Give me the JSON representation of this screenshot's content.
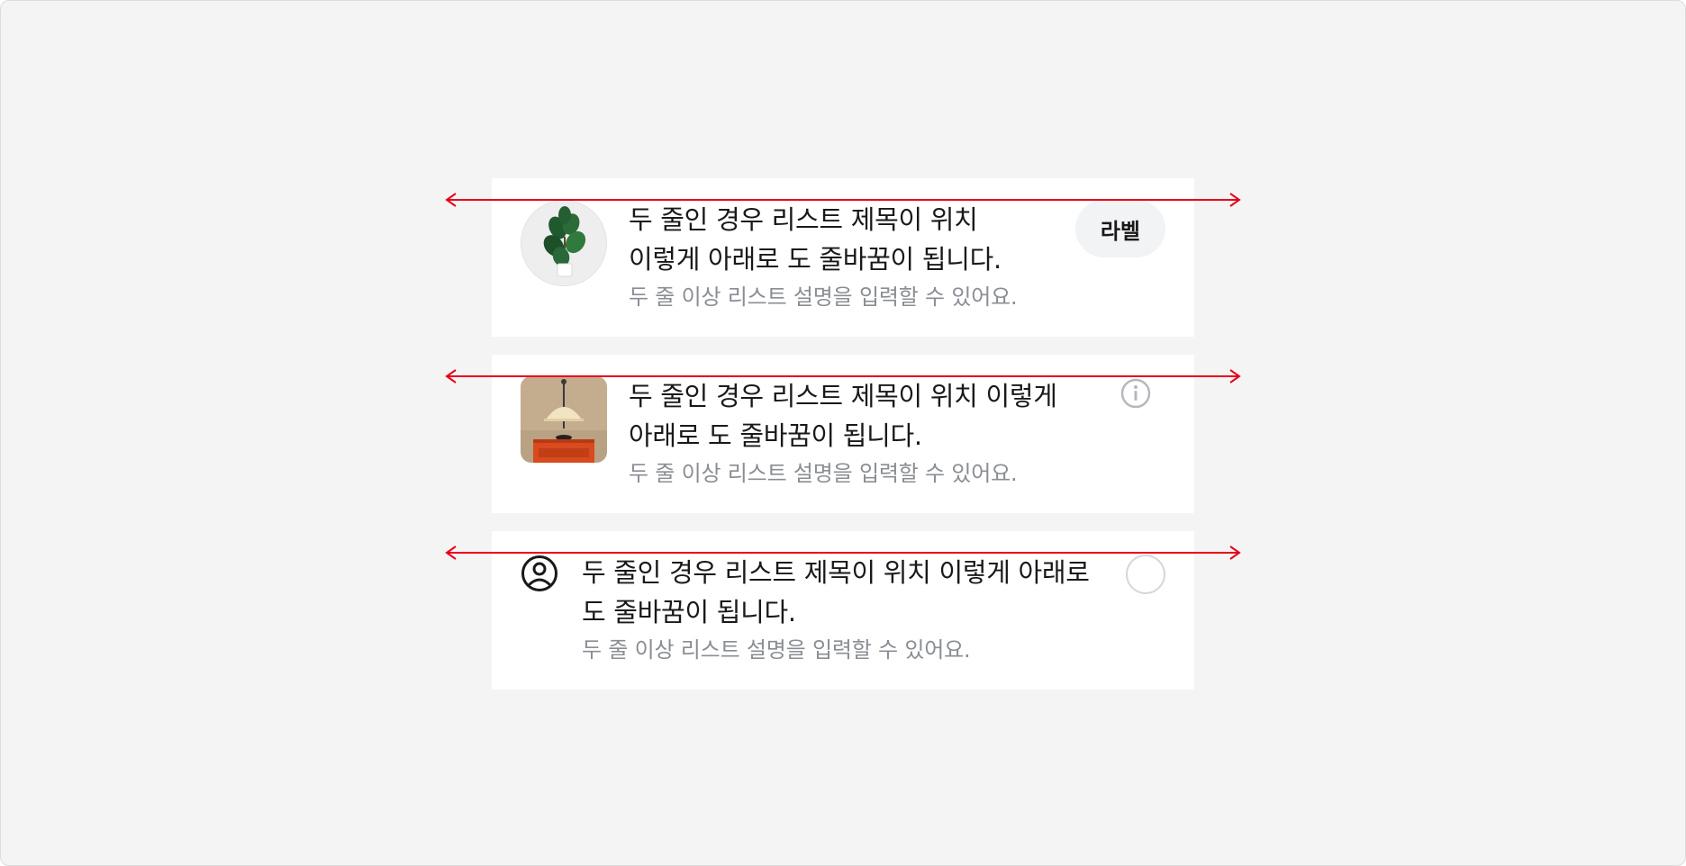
{
  "colors": {
    "background": "#f4f4f4",
    "card": "#ffffff",
    "title_text": "#191919",
    "description_text": "#8a8d93",
    "chip_background": "#f2f3f5",
    "guide_line": "#e8001c"
  },
  "items": [
    {
      "leading": "plant-thumbnail",
      "title": "두 줄인 경우 리스트 제목이 위치 이렇게 아래로 도 줄바꿈이 됩니다.",
      "description": "두 줄 이상 리스트 설명을 입력할 수 있어요.",
      "trailing": {
        "type": "label-chip",
        "label": "라벨"
      }
    },
    {
      "leading": "lamp-thumbnail",
      "title": "두 줄인 경우 리스트 제목이 위치 이렇게 아래로 도 줄바꿈이 됩니다.",
      "description": "두 줄 이상 리스트 설명을 입력할 수 있어요.",
      "trailing": {
        "type": "info-icon"
      }
    },
    {
      "leading": "user-circle-icon",
      "title": "두 줄인 경우 리스트 제목이 위치 이렇게 아래로 도 줄바꿈이 됩니다.",
      "description": "두 줄 이상 리스트 설명을 입력할 수 있어요.",
      "trailing": {
        "type": "radio-button",
        "checked": false
      }
    }
  ]
}
